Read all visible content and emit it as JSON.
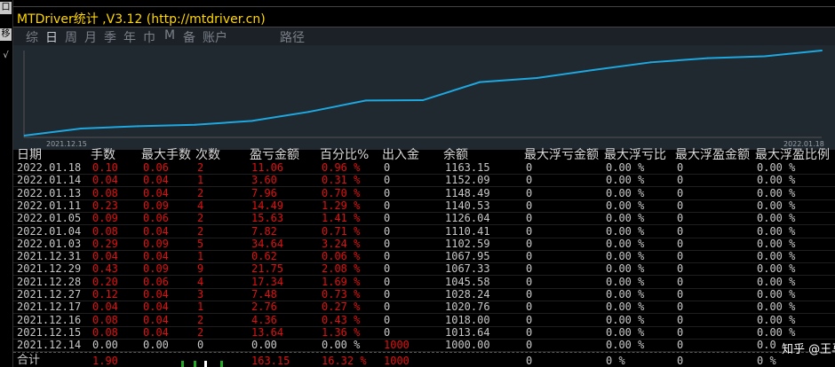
{
  "window": {
    "title": "MTDriver统计 ,V3.12 (http://mtdriver.cn)"
  },
  "left_strip": [
    "口",
    "移",
    "√"
  ],
  "tabs": [
    {
      "label": "综",
      "active": false
    },
    {
      "label": "日",
      "active": true
    },
    {
      "label": "周",
      "active": false
    },
    {
      "label": "月",
      "active": false
    },
    {
      "label": "季",
      "active": false
    },
    {
      "label": "年",
      "active": false
    },
    {
      "label": "巾",
      "active": false
    },
    {
      "label": "M",
      "active": false
    },
    {
      "label": "备",
      "active": false
    },
    {
      "label": "账户",
      "active": false
    },
    {
      "label": "路径",
      "active": false
    }
  ],
  "chart_data": {
    "type": "line",
    "x": [
      "2021.12.15",
      "2021.12.16",
      "2021.12.17",
      "2021.12.27",
      "2021.12.28",
      "2021.12.29",
      "2021.12.31",
      "2022.01.03",
      "2022.01.04",
      "2022.01.05",
      "2022.01.11",
      "2022.01.13",
      "2022.01.14",
      "2022.01.18"
    ],
    "series": [
      {
        "values": [
          1013.64,
          1018.0,
          1020.76,
          1028.24,
          1045.58,
          1067.33,
          1067.95,
          1102.59,
          1110.41,
          1126.04,
          1140.53,
          1148.49,
          1152.09,
          1163.15
        ]
      }
    ],
    "x_start_label": "2021.12.15",
    "x_end_label": "2022.01.18",
    "color": "#1ea8e0"
  },
  "table": {
    "headers": [
      "日期",
      "手数",
      "最大手数",
      "次数",
      "盈亏金额",
      "百分比%",
      "出入金",
      "余额",
      "最大浮亏金额",
      "最大浮亏比",
      "最大浮盈金额",
      "最大浮盈比例"
    ],
    "rows": [
      [
        "2022.01.18",
        "0.10",
        "0.06",
        "2",
        "11.06",
        "0.96 %",
        "0",
        "1163.15",
        "0",
        "0.00 %",
        "0",
        "0.00 %"
      ],
      [
        "2022.01.14",
        "0.04",
        "0.04",
        "1",
        "3.60",
        "0.31 %",
        "0",
        "1152.09",
        "0",
        "0.00 %",
        "0",
        "0.00 %"
      ],
      [
        "2022.01.13",
        "0.08",
        "0.04",
        "2",
        "7.96",
        "0.70 %",
        "0",
        "1148.49",
        "0",
        "0.00 %",
        "0",
        "0.00 %"
      ],
      [
        "2022.01.11",
        "0.23",
        "0.09",
        "4",
        "14.49",
        "1.29 %",
        "0",
        "1140.53",
        "0",
        "0.00 %",
        "0",
        "0.00 %"
      ],
      [
        "2022.01.05",
        "0.09",
        "0.06",
        "2",
        "15.63",
        "1.41 %",
        "0",
        "1126.04",
        "0",
        "0.00 %",
        "0",
        "0.00 %"
      ],
      [
        "2022.01.04",
        "0.08",
        "0.04",
        "2",
        "7.82",
        "0.71 %",
        "0",
        "1110.41",
        "0",
        "0.00 %",
        "0",
        "0.00 %"
      ],
      [
        "2022.01.03",
        "0.29",
        "0.09",
        "5",
        "34.64",
        "3.24 %",
        "0",
        "1102.59",
        "0",
        "0.00 %",
        "0",
        "0.00 %"
      ],
      [
        "2021.12.31",
        "0.04",
        "0.04",
        "1",
        "0.62",
        "0.06 %",
        "0",
        "1067.95",
        "0",
        "0.00 %",
        "0",
        "0.00 %"
      ],
      [
        "2021.12.29",
        "0.43",
        "0.09",
        "9",
        "21.75",
        "2.08 %",
        "0",
        "1067.33",
        "0",
        "0.00 %",
        "0",
        "0.00 %"
      ],
      [
        "2021.12.28",
        "0.20",
        "0.06",
        "4",
        "17.34",
        "1.69 %",
        "0",
        "1045.58",
        "0",
        "0.00 %",
        "0",
        "0.00 %"
      ],
      [
        "2021.12.27",
        "0.12",
        "0.04",
        "3",
        "7.48",
        "0.73 %",
        "0",
        "1028.24",
        "0",
        "0.00 %",
        "0",
        "0.00 %"
      ],
      [
        "2021.12.17",
        "0.04",
        "0.04",
        "1",
        "2.76",
        "0.27 %",
        "0",
        "1020.76",
        "0",
        "0.00 %",
        "0",
        "0.00 %"
      ],
      [
        "2021.12.16",
        "0.08",
        "0.04",
        "2",
        "4.36",
        "0.43 %",
        "0",
        "1018.00",
        "0",
        "0.00 %",
        "0",
        "0.00 %"
      ],
      [
        "2021.12.15",
        "0.08",
        "0.04",
        "2",
        "13.64",
        "1.36 %",
        "0",
        "1013.64",
        "0",
        "0.00 %",
        "0",
        "0.00 %"
      ],
      [
        "2021.12.14",
        "0.00",
        "0.00",
        "0",
        "0.00",
        "0.00 %",
        "1000",
        "1000.00",
        "0",
        "0.00 %",
        "0",
        "0.0"
      ]
    ],
    "summary": [
      "合计",
      "1.90",
      "",
      "",
      "163.15",
      "16.32 %",
      "1000",
      "",
      "0",
      "0 %",
      "0",
      "0 %"
    ]
  },
  "watermark": "知乎 @王马",
  "colors": {
    "profit": "#e01010",
    "normal": "#c8c8c8",
    "title": "#ffd700",
    "line": "#1ea8e0"
  }
}
